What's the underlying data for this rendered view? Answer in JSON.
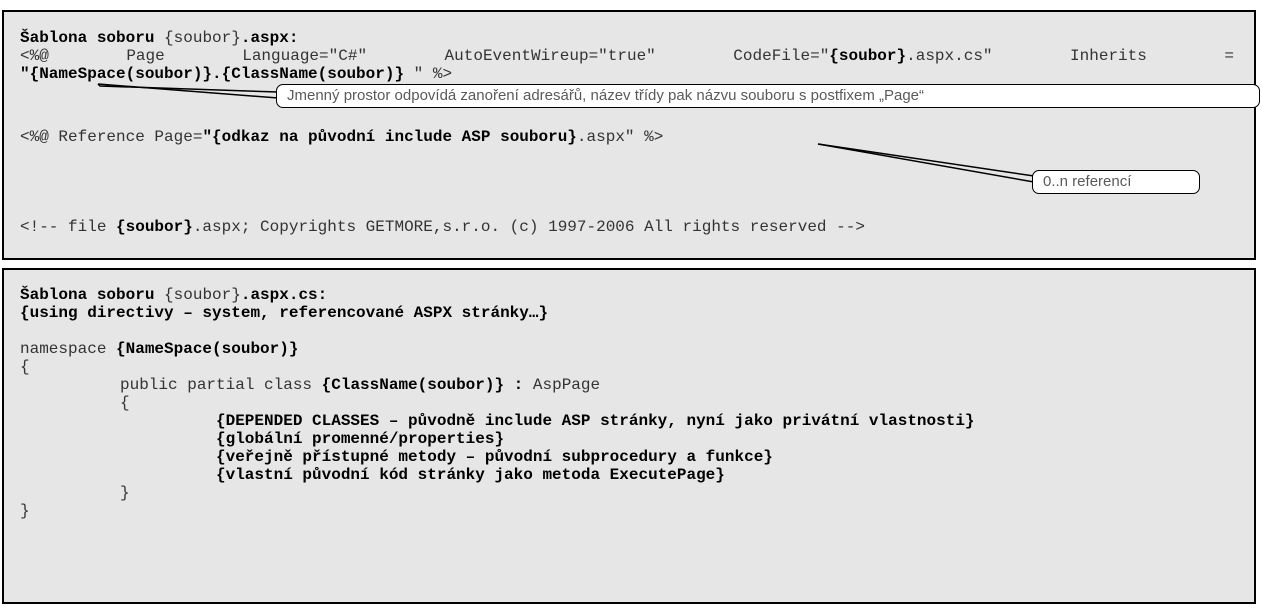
{
  "aspx_template": {
    "title_bold": "Šablona soboru",
    "title_placeholder": "{soubor}",
    "title_ext": ".aspx:",
    "page_directive": {
      "tokens": [
        "<%@",
        "Page",
        "Language=\"C#\"",
        "AutoEventWireup=\"true\"",
        "CodeFile=\"{soubor}.aspx.cs\"",
        "Inherits",
        "="
      ],
      "codefile_prefix": "CodeFile=\"",
      "codefile_bold": "{soubor}",
      "codefile_suffix": ".aspx.cs\"",
      "inherits_value_bold": "\"{NameSpace(soubor)}.{ClassName(soubor)}",
      "inherits_value_tail": " \" %>"
    },
    "namespace_callout": "Jmenný prostor odpovídá zanoření adresářů, název třídy pak názvu souboru s postfixem „Page“",
    "reference_prefix": "<%@ Reference Page=",
    "reference_bold": "\"{odkaz na původní include ASP souboru}",
    "reference_suffix": ".aspx\" %>",
    "reference_callout": "0..n referencí",
    "comment_prefix": "<!-- file ",
    "comment_bold": "{soubor}",
    "comment_suffix": ".aspx; Copyrights GETMORE,s.r.o. (c) 1997-2006 All rights reserved -->"
  },
  "cs_template": {
    "title_bold": "Šablona soboru",
    "title_placeholder": "{soubor}",
    "title_ext": ".aspx.cs:",
    "using_line": "{using directivy – system, referencované ASPX stránky…}",
    "namespace_keyword": "namespace ",
    "namespace_bold": "{NameSpace(soubor)}",
    "open_brace": "{",
    "class_prefix": "public partial class ",
    "class_bold": "{ClassName(soubor)}",
    "class_colon": " :",
    "class_suffix": " AspPage",
    "inner_open_brace": "{",
    "members": [
      "{DEPENDED CLASSES – původně include ASP stránky, nyní jako privátní vlastnosti}",
      "{globální promenné/properties}",
      "{veřejně přístupné metody – původní subprocedury a funkce}",
      "{vlastní původní kód stránky jako metoda ExecutePage}"
    ],
    "inner_close_brace": "}",
    "close_brace": "}"
  }
}
